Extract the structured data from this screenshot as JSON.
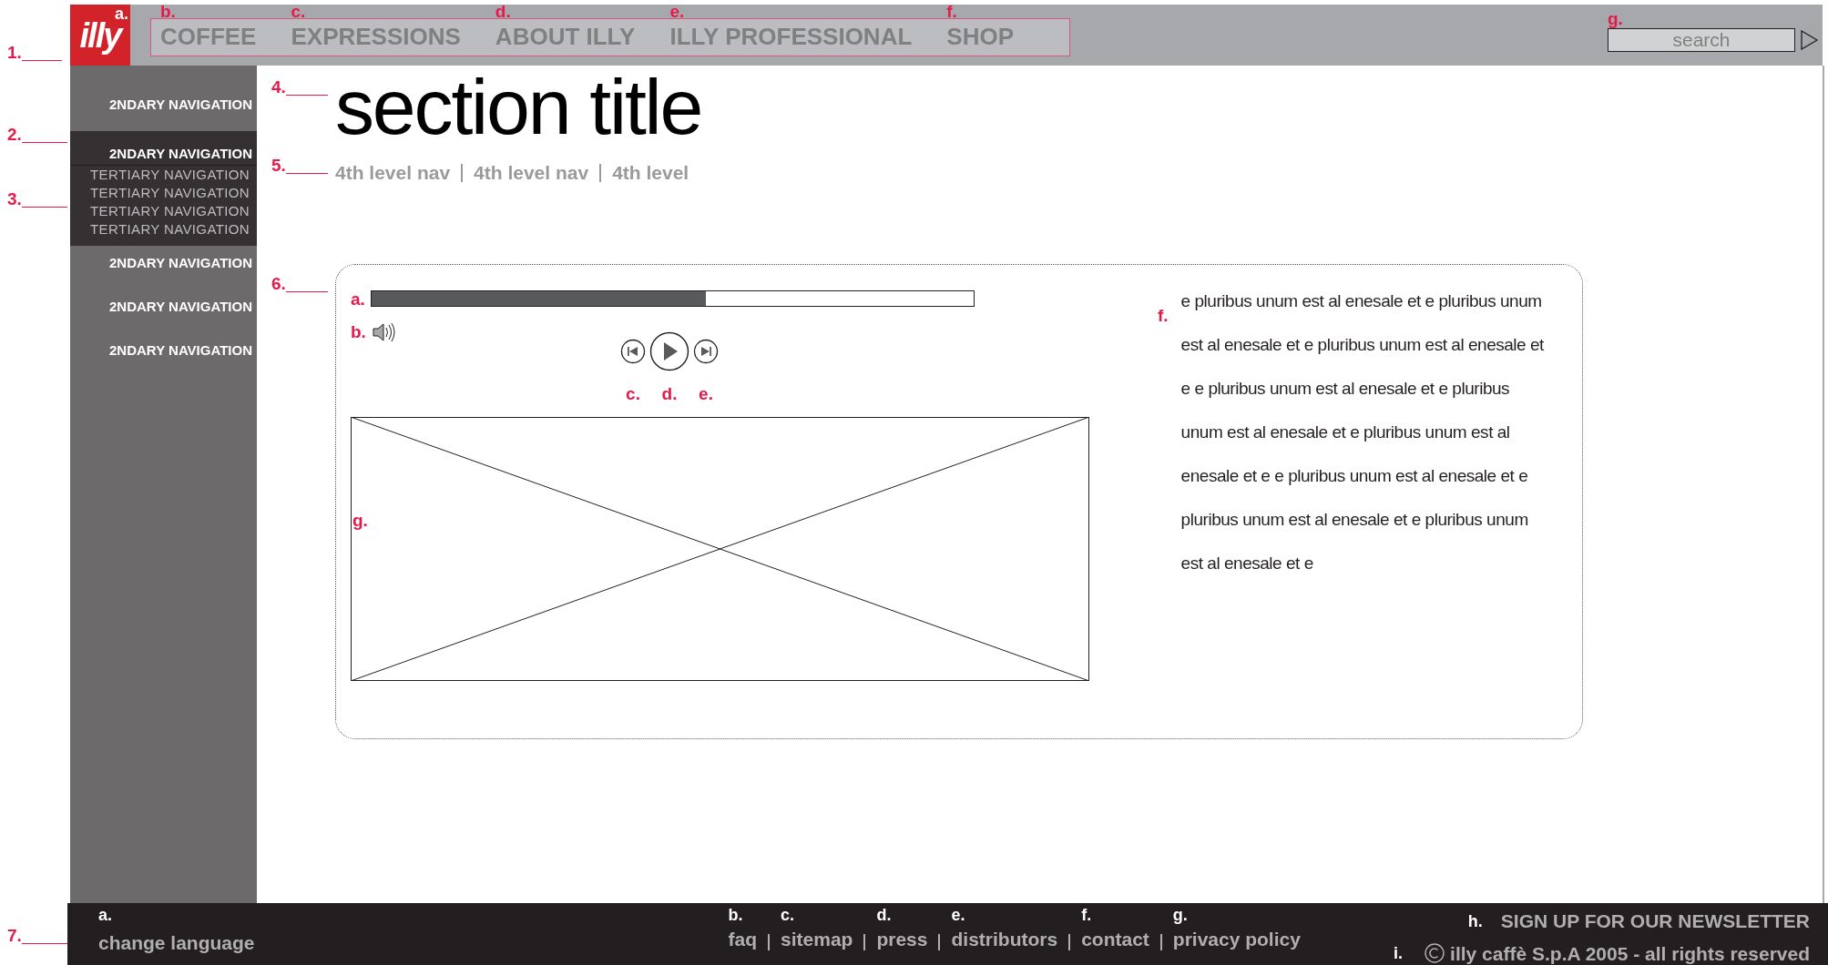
{
  "header": {
    "callout": "1.",
    "logo": {
      "marker": "a.",
      "text": "illy"
    },
    "nav": [
      {
        "marker": "b.",
        "label": "COFFEE"
      },
      {
        "marker": "c.",
        "label": "EXPRESSIONS"
      },
      {
        "marker": "d.",
        "label": "ABOUT ILLY"
      },
      {
        "marker": "e.",
        "label": "ILLY PROFESSIONAL"
      },
      {
        "marker": "f.",
        "label": "SHOP"
      }
    ],
    "search": {
      "marker": "g.",
      "placeholder": "search"
    }
  },
  "sidebar": {
    "callouts": [
      "2.",
      "3."
    ],
    "items": [
      {
        "label": "2NDARY NAVIGATION",
        "selected": false
      },
      {
        "label": "2NDARY NAVIGATION",
        "selected": true,
        "children": [
          {
            "label": "TERTIARY NAVIGATION"
          },
          {
            "label": "TERTIARY NAVIGATION"
          },
          {
            "label": "TERTIARY NAVIGATION"
          },
          {
            "label": "TERTIARY NAVIGATION"
          }
        ]
      },
      {
        "label": "2NDARY NAVIGATION",
        "selected": false
      },
      {
        "label": "2NDARY NAVIGATION",
        "selected": false
      },
      {
        "label": "2NDARY NAVIGATION",
        "selected": false
      }
    ]
  },
  "section": {
    "callout": "4.",
    "title": "section title"
  },
  "fourth_nav": {
    "callout": "5.",
    "items": [
      "4th level nav",
      "4th level nav",
      "4th level"
    ]
  },
  "media": {
    "callout": "6.",
    "progress": {
      "marker": "a.",
      "level": 0.555
    },
    "volume": {
      "marker": "b."
    },
    "controls": [
      {
        "marker": "c.",
        "kind": "previous"
      },
      {
        "marker": "d.",
        "kind": "play"
      },
      {
        "marker": "e.",
        "kind": "next"
      }
    ],
    "video": {
      "marker": "g."
    },
    "text": {
      "marker": "f.",
      "body": "e pluribus unum est al enesale et e pluribus unum est al enesale et e pluribus unum est al enesale et e e pluribus unum est al enesale et e pluribus unum est al enesale et e pluribus unum est al enesale et e e pluribus unum est al enesale et e pluribus unum est al enesale et e pluribus unum est al enesale et e"
    }
  },
  "footer": {
    "callout": "7.",
    "language": {
      "marker": "a.",
      "label": "change language"
    },
    "links": [
      {
        "marker": "b.",
        "label": "faq"
      },
      {
        "marker": "c.",
        "label": "sitemap"
      },
      {
        "marker": "d.",
        "label": "press"
      },
      {
        "marker": "e.",
        "label": "distributors"
      },
      {
        "marker": "f.",
        "label": "contact"
      },
      {
        "marker": "g.",
        "label": "privacy policy"
      }
    ],
    "newsletter": {
      "marker": "h.",
      "label": "SIGN UP FOR OUR NEWSLETTER"
    },
    "copyright": {
      "marker": "i.",
      "label": "illy caffè S.p.A 2005 - all rights reserved"
    }
  }
}
